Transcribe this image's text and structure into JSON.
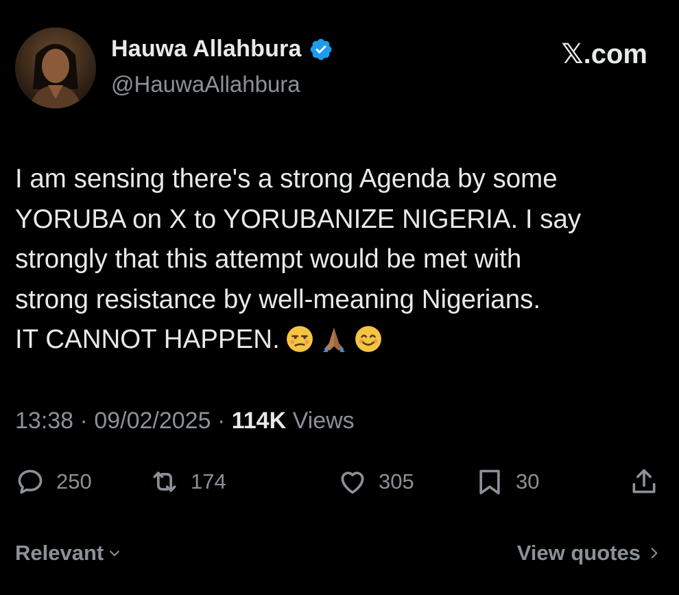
{
  "author": {
    "name": "Hauwa Allahbura",
    "handle": "@HauwaAllahbura",
    "verified_color": "#1d9bf0"
  },
  "brand": "𝕏.com",
  "tweet": {
    "text": "I am sensing there's a strong Agenda by some\nYORUBA on X to YORUBANIZE NIGERIA. I say\nstrongly that this attempt would be met with\nstrong resistance by well-meaning Nigerians.\nIT CANNOT HAPPEN.",
    "emojis": [
      "unamused-face",
      "folded-hands",
      "smiling-face"
    ]
  },
  "meta": {
    "time": "13:38",
    "separator": "·",
    "date": "09/02/2025",
    "views_count": "114K",
    "views_label": "Views"
  },
  "actions": {
    "replies": "250",
    "reposts": "174",
    "likes": "305",
    "bookmarks": "30"
  },
  "footer": {
    "sort_label": "Relevant",
    "quotes_label": "View quotes"
  },
  "icons": {
    "reply": "reply-icon",
    "repost": "repost-icon",
    "like": "like-icon",
    "bookmark": "bookmark-icon",
    "share": "share-icon"
  }
}
